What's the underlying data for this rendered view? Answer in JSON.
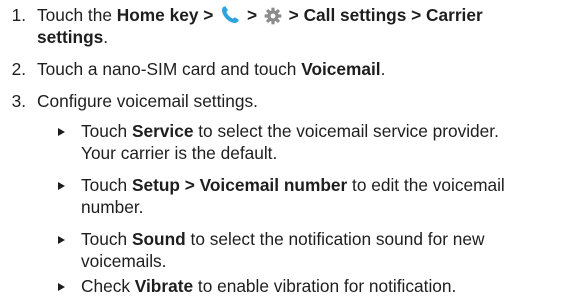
{
  "steps": [
    {
      "number": "1.",
      "touch": "Touch the",
      "home": "Home",
      "key": "key >",
      "sep1": ">",
      "sep2": "> Call settings > Carrier",
      "settings": "settings",
      "period": "."
    },
    {
      "number": "2.",
      "lead": "Touch a nano-SIM card and touch",
      "voicemail": "Voicemail",
      "period": "."
    },
    {
      "number": "3.",
      "text": "Configure voicemail settings."
    }
  ],
  "substeps": [
    {
      "a": "Touch",
      "b": "Service",
      "c": "to select the voicemail service provider.",
      "d": "Your carrier is the default."
    },
    {
      "a": "Touch",
      "b": "Setup > Voicemail number",
      "c": "to edit the voicemail",
      "d": "number."
    },
    {
      "a": "Touch",
      "b": "Sound",
      "c": "to select the notification sound for new",
      "d": "voicemails."
    },
    {
      "a": "Check",
      "b": "Vibrate",
      "c": "to enable vibration for notification."
    }
  ],
  "icons": {
    "phone": "phone-icon",
    "gear": "gear-icon",
    "bullet": "triangle-bullet-icon"
  },
  "colors": {
    "phone_icon": "#2ea4de",
    "gear_icon": "#8c8c8c",
    "text": "#1e1e1e"
  }
}
